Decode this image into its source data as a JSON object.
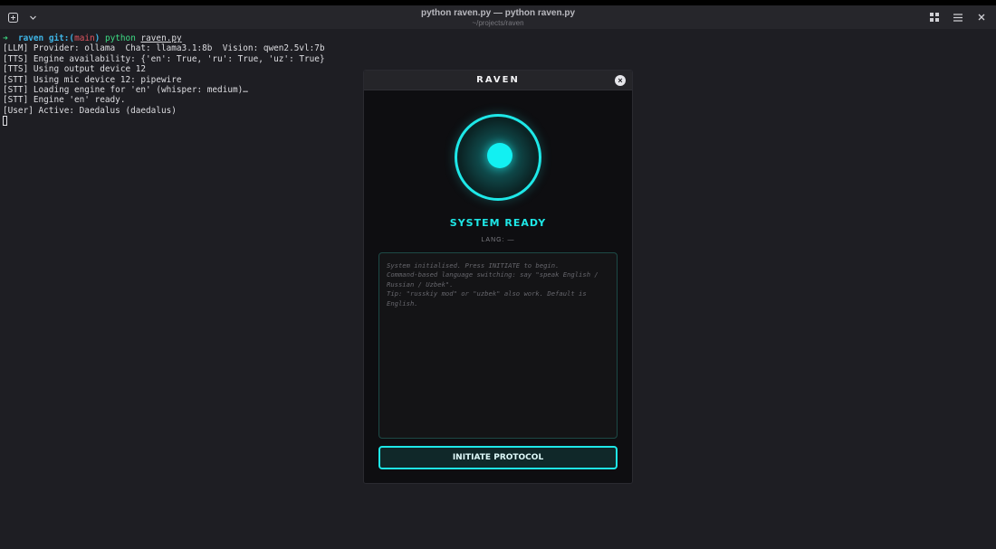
{
  "window": {
    "title": "python raven.py — python raven.py",
    "subtitle": "~/projects/raven"
  },
  "terminal": {
    "prompt": {
      "arrow": "➜",
      "dir": "raven",
      "git_prefix": "git:(",
      "branch": "main",
      "git_suffix": ")",
      "cmd": "python",
      "file": "raven.py"
    },
    "lines": [
      "[LLM] Provider: ollama  Chat: llama3.1:8b  Vision: qwen2.5vl:7b",
      "[TTS] Engine availability: {'en': True, 'ru': True, 'uz': True}",
      "[TTS] Using output device 12",
      "[STT] Using mic device 12: pipewire",
      "[STT] Loading engine for 'en' (whisper: medium)…",
      "[STT] Engine 'en' ready.",
      "[User] Active: Daedalus (daedalus)"
    ]
  },
  "app": {
    "title": "RAVEN",
    "close_symbol": "×",
    "status": "SYSTEM READY",
    "lang": "LANG: —",
    "log_lines": [
      "System initialised. Press INITIATE to begin.",
      "Command-based language switching: say \"speak English /",
      "Russian / Uzbek\".",
      "Tip: \"russkiy mod\" or \"uzbek\" also work. Default is",
      "English."
    ],
    "button_label": "INITIATE PROTOCOL"
  },
  "colors": {
    "accent": "#1ee8e8",
    "background": "#1e1e23",
    "panel": "#0e0e11"
  }
}
